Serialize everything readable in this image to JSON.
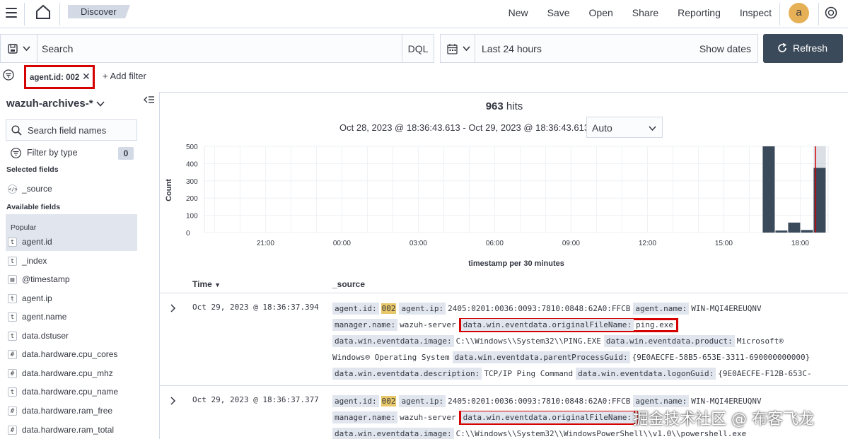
{
  "header": {
    "breadcrumb": "Discover",
    "links": [
      "New",
      "Save",
      "Open",
      "Share",
      "Reporting",
      "Inspect"
    ],
    "avatar": "a"
  },
  "query": {
    "search_placeholder": "Search",
    "language": "DQL",
    "time_range": "Last 24 hours",
    "show_dates": "Show dates",
    "refresh": "Refresh"
  },
  "filters": {
    "pill": "agent.id: 002",
    "add_filter": "+ Add filter"
  },
  "sidebar": {
    "index_pattern": "wazuh-archives-*",
    "search_placeholder": "Search field names",
    "filter_by_type": "Filter by type",
    "filter_count": "0",
    "selected_title": "Selected fields",
    "selected": [
      {
        "type": "</>",
        "name": "_source"
      }
    ],
    "available_title": "Available fields",
    "popular_title": "Popular",
    "fields": [
      {
        "type": "t",
        "name": "agent.id"
      },
      {
        "type": "t",
        "name": "_index"
      },
      {
        "type": "▤",
        "name": "@timestamp"
      },
      {
        "type": "t",
        "name": "agent.ip"
      },
      {
        "type": "t",
        "name": "agent.name"
      },
      {
        "type": "t",
        "name": "data.dstuser"
      },
      {
        "type": "#",
        "name": "data.hardware.cpu_cores"
      },
      {
        "type": "#",
        "name": "data.hardware.cpu_mhz"
      },
      {
        "type": "t",
        "name": "data.hardware.cpu_name"
      },
      {
        "type": "#",
        "name": "data.hardware.ram_free"
      },
      {
        "type": "#",
        "name": "data.hardware.ram_total"
      }
    ]
  },
  "main": {
    "hits_count": "963",
    "hits_label": "hits",
    "date_range": "Oct 28, 2023 @ 18:36:43.613 - Oct 29, 2023 @ 18:36:43.613",
    "interval": "Auto",
    "col_time": "Time",
    "col_source": "_source"
  },
  "chart_data": {
    "type": "bar",
    "ylabel": "Count",
    "xlabel": "timestamp per 30 minutes",
    "yticks": [
      0,
      100,
      200,
      300,
      400,
      500
    ],
    "ylim": [
      0,
      500
    ],
    "xticks": [
      "21:00",
      "00:00",
      "03:00",
      "06:00",
      "09:00",
      "12:00",
      "15:00",
      "18:00"
    ],
    "xticks_hours": [
      21,
      24,
      27,
      30,
      33,
      36,
      39,
      42
    ],
    "xlim_hours": [
      18.6,
      43.1
    ],
    "bars": [
      {
        "x_hours": 40.5,
        "value": 0
      },
      {
        "x_hours": 41.0,
        "value": 500
      },
      {
        "x_hours": 41.5,
        "value": 12
      },
      {
        "x_hours": 42.0,
        "value": 58
      },
      {
        "x_hours": 42.5,
        "value": 15
      },
      {
        "x_hours": 43.0,
        "value": 375
      }
    ],
    "current_time_hours": 42.6,
    "colors": {
      "bar": "#3b4a5a",
      "bar_highlight": "#9aa7b8",
      "marker": "#d60000"
    }
  },
  "docs": [
    {
      "time": "Oct 29, 2023 @ 18:36:37.394",
      "rows": [
        [
          {
            "k": "agent.id:",
            "v": "002",
            "hl": true
          },
          {
            "k": "agent.ip:",
            "v": "2405:0201:0036:0093:7810:0848:62A0:FFCB"
          },
          {
            "k": "agent.name:",
            "v": "WIN-MQI4EREUQNV"
          }
        ],
        [
          {
            "k": "manager.name:",
            "v": "wazuh-server"
          },
          {
            "k": "data.win.eventdata.originalFileName:",
            "v": "ping.exe",
            "box": true
          }
        ],
        [
          {
            "k": "data.win.eventdata.image:",
            "v": "C:\\\\Windows\\\\System32\\\\PING.EXE"
          },
          {
            "k": "data.win.eventdata.product:",
            "v": "Microsoft®"
          }
        ],
        [
          {
            "k": "",
            "v": "Windows® Operating System"
          },
          {
            "k": "data.win.eventdata.parentProcessGuid:",
            "v": "{9E0AECFE-58B5-653E-3311-690000000000}"
          }
        ],
        [
          {
            "k": "data.win.eventdata.description:",
            "v": "TCP/IP Ping Command"
          },
          {
            "k": "data.win.eventdata.logonGuid:",
            "v": "{9E0AECFE-F12B-653C-"
          }
        ]
      ]
    },
    {
      "time": "Oct 29, 2023 @ 18:36:37.377",
      "rows": [
        [
          {
            "k": "agent.id:",
            "v": "002",
            "hl": true
          },
          {
            "k": "agent.ip:",
            "v": "2405:0201:0036:0093:7810:0848:62A0:FFCB"
          },
          {
            "k": "agent.name:",
            "v": "WIN-MQI4EREUQNV"
          }
        ],
        [
          {
            "k": "manager.name:",
            "v": "wazuh-server"
          },
          {
            "k": "data.win.eventdata.originalFileName:",
            "v": "",
            "box": true
          }
        ],
        [
          {
            "k": "data.win.eventdata.image:",
            "v": "C:\\\\Windows\\\\System32\\\\WindowsPowerShell\\\\v1.0\\\\powershell.exe"
          }
        ]
      ]
    }
  ],
  "watermark": "掘金技术社区 @ 布客飞龙"
}
